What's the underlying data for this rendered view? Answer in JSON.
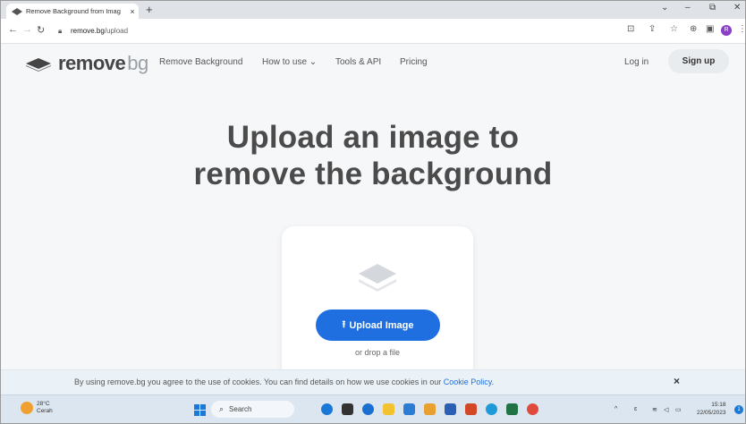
{
  "browser": {
    "tab_title": "Remove Background from Imag",
    "tab_close": "×",
    "new_tab": "+",
    "url_host": "remove.bg",
    "url_path": "/upload",
    "profile_initial": "R",
    "window_controls": {
      "collapse": "⌄",
      "minimize": "–",
      "restore": "⧉",
      "close": "✕"
    }
  },
  "site": {
    "logo_word": "remove",
    "logo_suffix": "bg",
    "nav": [
      {
        "label": "Remove Background"
      },
      {
        "label": "How to use ⌄"
      },
      {
        "label": "Tools & API"
      },
      {
        "label": "Pricing"
      }
    ],
    "login": "Log in",
    "signup": "Sign up"
  },
  "hero": {
    "line1": "Upload an image to",
    "line2": "remove the background"
  },
  "upload": {
    "button": "Upload Image",
    "drop_hint": "or drop a file"
  },
  "cookie": {
    "text": "By using remove.bg you agree to the use of cookies. You can find details on how we use cookies in our ",
    "link": "Cookie Policy",
    "period": ".",
    "close": "×"
  },
  "taskbar": {
    "weather_temp": "28°C",
    "weather_desc": "Cerah",
    "search_label": "Search",
    "time": "15:18",
    "date": "22/05/2023",
    "notification_count": "1",
    "tray_caret": "^",
    "ime": "ɛ"
  },
  "colors": {
    "accent": "#1f6fe0",
    "headline": "#4b4b4b",
    "page_bg": "#f6f7f9",
    "cookie_bg": "#eaf2f8",
    "taskbar_bg": "#dce6f0"
  }
}
